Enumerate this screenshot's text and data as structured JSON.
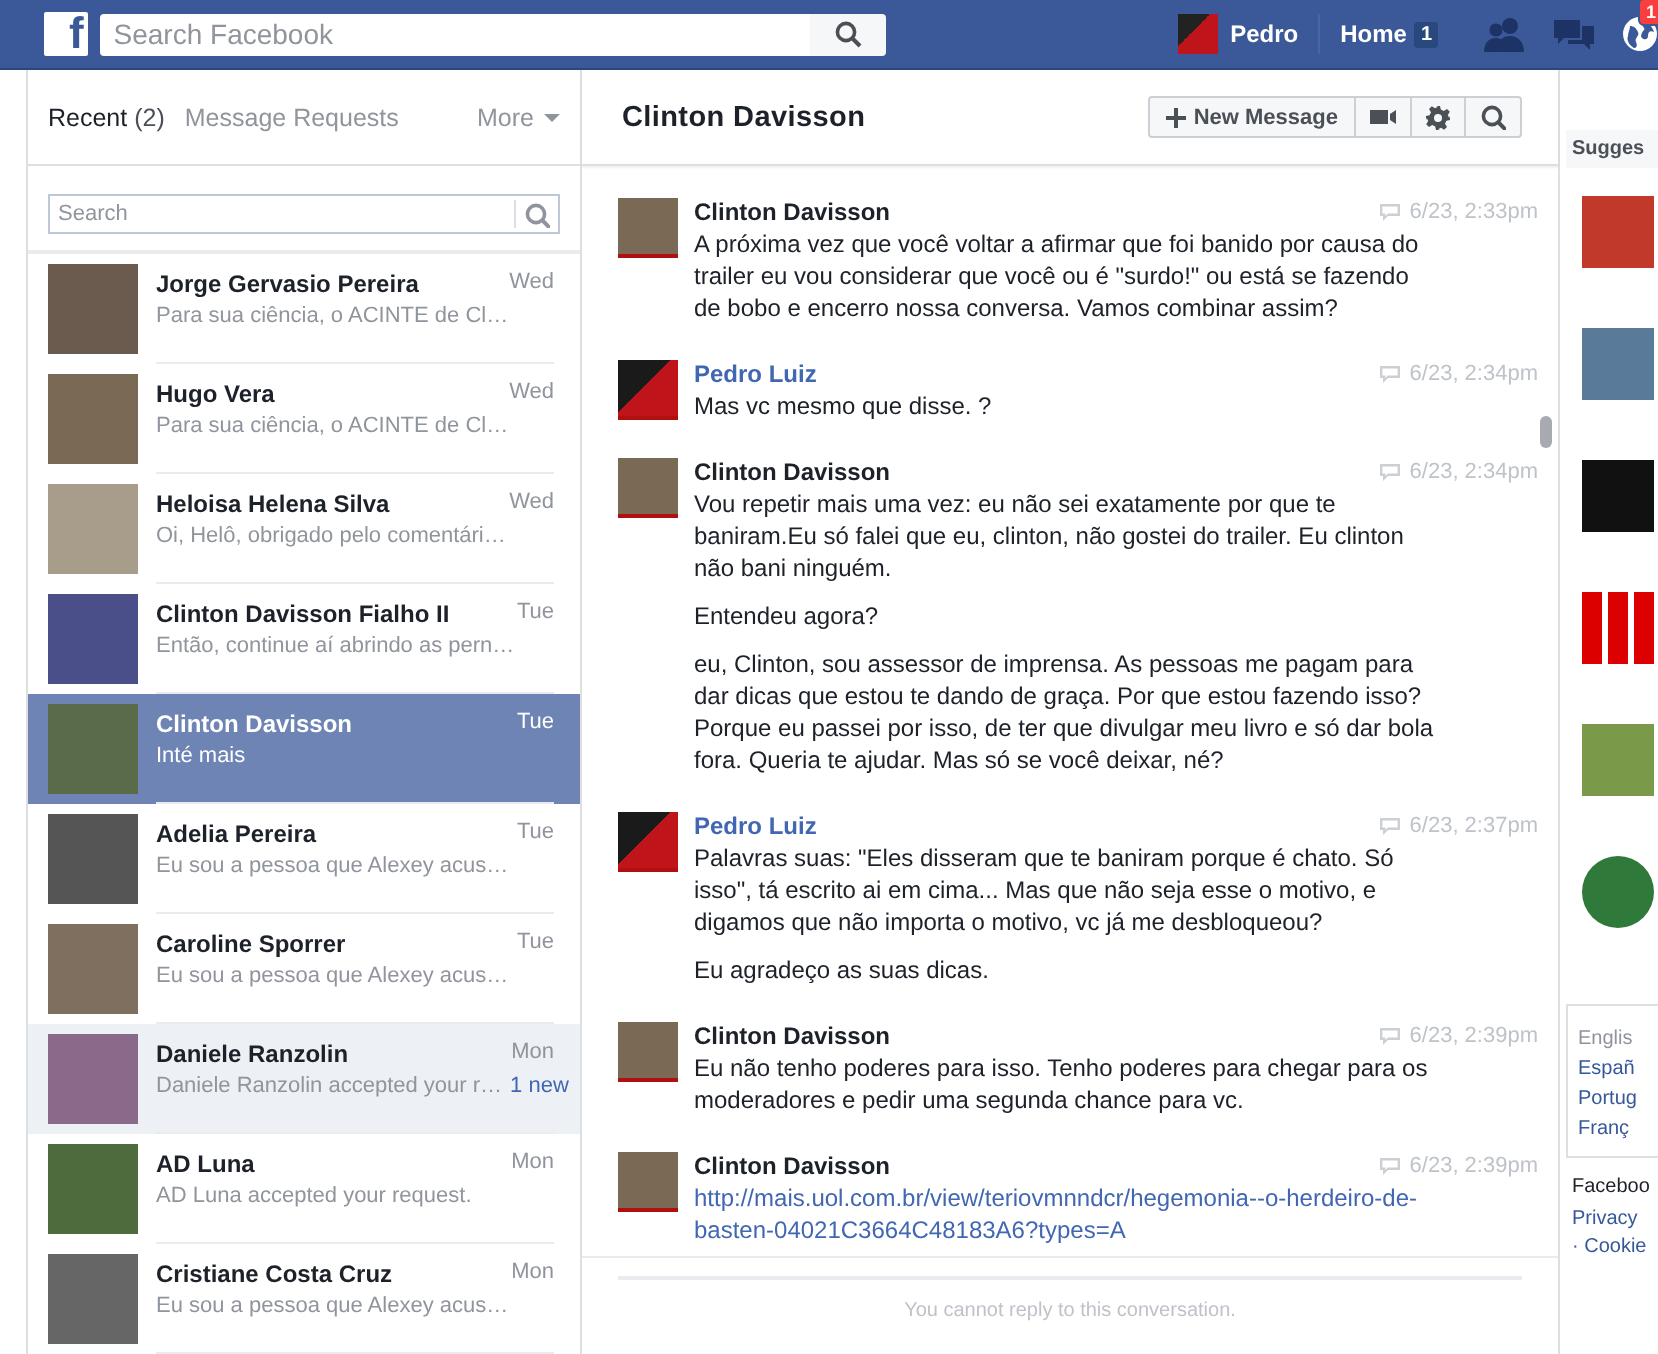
{
  "topbar": {
    "logo": "f",
    "search": {
      "placeholder": "Search Facebook"
    },
    "user_name": "Pedro",
    "home": "Home",
    "home_count": "1",
    "notifications_count": "1"
  },
  "inbox": {
    "tabs": [
      {
        "label": "Recent",
        "count": "(2)",
        "selected": true
      },
      {
        "label": "Message Requests",
        "selected": false
      }
    ],
    "more": "More",
    "search": {
      "placeholder": "Search"
    },
    "conversations": [
      {
        "name": "Jorge Gervasio Pereira",
        "snippet": "Para sua ciência, o ACINTE de Cl…",
        "time": "Wed",
        "selected": false,
        "unread": false
      },
      {
        "name": "Hugo Vera",
        "snippet": "Para sua ciência, o ACINTE de Cl…",
        "time": "Wed",
        "selected": false,
        "unread": false
      },
      {
        "name": "Heloisa Helena Silva",
        "snippet": "Oi, Helô, obrigado pelo comentári…",
        "time": "Wed",
        "selected": false,
        "unread": false
      },
      {
        "name": "Clinton Davisson Fialho II",
        "snippet": "Então, continue aí abrindo as pern…",
        "time": "Tue",
        "selected": false,
        "unread": false
      },
      {
        "name": "Clinton Davisson",
        "snippet": "Inté mais",
        "time": "Tue",
        "selected": true,
        "unread": false
      },
      {
        "name": "Adelia Pereira",
        "snippet": "Eu sou a pessoa que Alexey acus…",
        "time": "Tue",
        "selected": false,
        "unread": false
      },
      {
        "name": "Caroline Sporrer",
        "snippet": "Eu sou a pessoa que Alexey acus…",
        "time": "Tue",
        "selected": false,
        "unread": false
      },
      {
        "name": "Daniele Ranzolin",
        "snippet": "Daniele Ranzolin accepted your r…",
        "time": "Mon",
        "selected": false,
        "unread": true,
        "badge": "1 new"
      },
      {
        "name": "AD Luna",
        "snippet": "AD Luna accepted your request.",
        "time": "Mon",
        "selected": false,
        "unread": false
      },
      {
        "name": "Cristiane Costa Cruz",
        "snippet": "Eu sou a pessoa que Alexey acus…",
        "time": "Mon",
        "selected": false,
        "unread": false
      }
    ]
  },
  "thread": {
    "title": "Clinton Davisson",
    "new_message": "New Message",
    "messages": [
      {
        "sender": "Clinton Davisson",
        "is_me": false,
        "time": "6/23, 2:33pm",
        "paragraphs": [
          {
            "kind": "text",
            "text": "A próxima vez que você voltar a afirmar que foi banido por causa do trailer eu vou considerar que você ou é \"surdo!\" ou está se fazendo de bobo e encerro nossa conversa. Vamos combinar assim?"
          }
        ]
      },
      {
        "sender": "Pedro Luiz",
        "is_me": true,
        "time": "6/23, 2:34pm",
        "paragraphs": [
          {
            "kind": "text",
            "text": "Mas vc mesmo que disse. ?"
          }
        ]
      },
      {
        "sender": "Clinton Davisson",
        "is_me": false,
        "time": "6/23, 2:34pm",
        "paragraphs": [
          {
            "kind": "text",
            "text": "Vou repetir mais uma vez: eu não sei exatamente por que te baniram.Eu só falei que eu, clinton, não gostei do trailer. Eu clinton não bani ninguém."
          },
          {
            "kind": "text",
            "text": "Entendeu agora?"
          },
          {
            "kind": "text",
            "text": "eu, Clinton, sou assessor de imprensa. As pessoas me pagam para dar dicas que estou te dando de graça. Por que estou fazendo isso? Porque eu passei por isso, de ter que divulgar meu livro e só dar bola fora. Queria te ajudar. Mas só se você deixar, né?"
          }
        ]
      },
      {
        "sender": "Pedro Luiz",
        "is_me": true,
        "time": "6/23, 2:37pm",
        "paragraphs": [
          {
            "kind": "text",
            "text": "Palavras suas: \"Eles disseram que te baniram porque é chato. Só isso\", tá escrito ai em cima... Mas que não seja esse o motivo, e digamos que não importa o motivo, vc já me desbloqueou?"
          },
          {
            "kind": "text",
            "text": "Eu agradeço as suas dicas."
          }
        ]
      },
      {
        "sender": "Clinton Davisson",
        "is_me": false,
        "time": "6/23, 2:39pm",
        "paragraphs": [
          {
            "kind": "text",
            "text": "Eu não tenho poderes para isso. Tenho poderes para chegar para os moderadores e pedir uma segunda chance para vc."
          }
        ]
      },
      {
        "sender": "Clinton Davisson",
        "is_me": false,
        "time": "6/23, 2:39pm",
        "paragraphs": [
          {
            "kind": "link",
            "text": "http://mais.uol.com.br/view/teriovmnndcr/hegemonia--o-herdeiro-de-basten-04021C3664C48183A6?types=A"
          }
        ]
      }
    ],
    "notice": "You cannot reply to this conversation."
  },
  "right_column": {
    "suggestions_title": "Sugges",
    "languages": [
      {
        "label": "Englis",
        "selected": true
      },
      {
        "label": "Españ",
        "selected": false
      },
      {
        "label": "Portug",
        "selected": false
      },
      {
        "label": "Franç",
        "selected": false
      }
    ],
    "footer_links": [
      "Faceboo",
      "Privacy",
      "· Cookie"
    ]
  }
}
